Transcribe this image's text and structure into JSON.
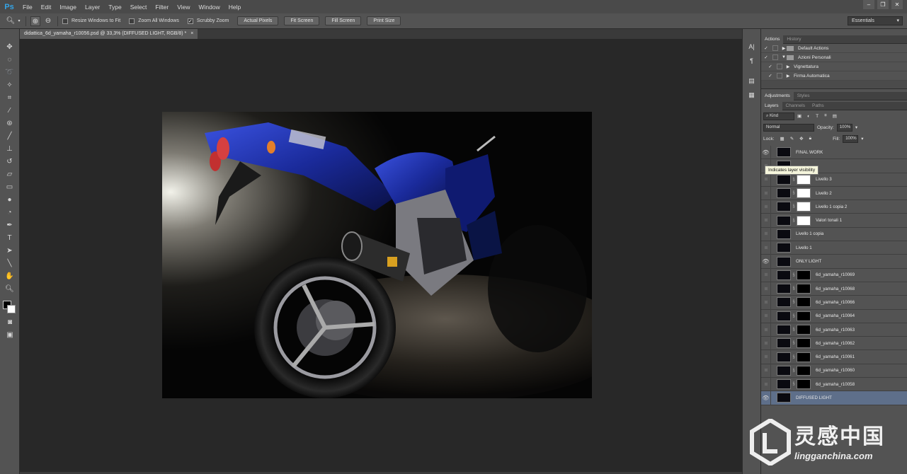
{
  "app": {
    "logo": "Ps"
  },
  "menu": [
    "File",
    "Edit",
    "Image",
    "Layer",
    "Type",
    "Select",
    "Filter",
    "View",
    "Window",
    "Help"
  ],
  "window_controls": [
    "–",
    "❐",
    "✕"
  ],
  "options_bar": {
    "checkboxes": [
      {
        "label": "Resize Windows to Fit",
        "checked": false
      },
      {
        "label": "Zoom All Windows",
        "checked": false
      },
      {
        "label": "Scrubby Zoom",
        "checked": true
      }
    ],
    "buttons": [
      "Actual Pixels",
      "Fit Screen",
      "Fill Screen",
      "Print Size"
    ],
    "workspace": "Essentials"
  },
  "document": {
    "tab_title": "didattica_6d_yamaha_r10056.psd @ 33,3% (DIFFUSED LIGHT, RGB/8) *",
    "close": "×"
  },
  "actions_panel": {
    "tabs": [
      "Actions",
      "History"
    ],
    "rows": [
      {
        "checked": "✓",
        "tri": "▶",
        "name": "Default Actions",
        "folder": true
      },
      {
        "checked": "✓",
        "tri": "▼",
        "name": "Azioni Personali",
        "folder": true
      },
      {
        "checked": "✓",
        "tri": "▶",
        "name": "Vignettatura",
        "folder": false
      },
      {
        "checked": "✓",
        "tri": "▶",
        "name": "Firma Automatica",
        "folder": false
      }
    ]
  },
  "adjustments_panel": {
    "tabs": [
      "Adjustments",
      "Styles"
    ]
  },
  "layers_panel": {
    "tabs": [
      "Layers",
      "Channels",
      "Paths"
    ],
    "kind": "Kind",
    "blend_mode": "Normal",
    "opacity_label": "Opacity:",
    "opacity_value": "100%",
    "lock_label": "Lock:",
    "fill_label": "Fill:",
    "fill_value": "100%",
    "tooltip": "Indicates layer visibility",
    "layers": [
      {
        "name": "FINAL WORK",
        "visible": true,
        "mask": "none",
        "selected": false
      },
      {
        "name": "",
        "visible": false,
        "mask": "none",
        "selected": false
      },
      {
        "name": "Livello 3",
        "visible": false,
        "mask": "white",
        "selected": false
      },
      {
        "name": "Livello 2",
        "visible": false,
        "mask": "white",
        "selected": false
      },
      {
        "name": "Livello 1 copia 2",
        "visible": false,
        "mask": "white",
        "selected": false
      },
      {
        "name": "Valori tonali 1",
        "visible": false,
        "mask": "white",
        "selected": false
      },
      {
        "name": "Livello 1 copia",
        "visible": false,
        "mask": "none",
        "selected": false
      },
      {
        "name": "Livello 1",
        "visible": false,
        "mask": "none",
        "selected": false
      },
      {
        "name": "ONLY LIGHT",
        "visible": true,
        "mask": "none",
        "selected": false
      },
      {
        "name": "6d_yamaha_r10069",
        "visible": false,
        "mask": "black",
        "selected": false
      },
      {
        "name": "6d_yamaha_r10068",
        "visible": false,
        "mask": "black",
        "selected": false
      },
      {
        "name": "6d_yamaha_r10066",
        "visible": false,
        "mask": "black",
        "selected": false
      },
      {
        "name": "6d_yamaha_r10064",
        "visible": false,
        "mask": "black",
        "selected": false
      },
      {
        "name": "6d_yamaha_r10063",
        "visible": false,
        "mask": "black",
        "selected": false
      },
      {
        "name": "6d_yamaha_r10062",
        "visible": false,
        "mask": "black",
        "selected": false
      },
      {
        "name": "6d_yamaha_r10061",
        "visible": false,
        "mask": "black",
        "selected": false
      },
      {
        "name": "6d_yamaha_r10060",
        "visible": false,
        "mask": "black",
        "selected": false
      },
      {
        "name": "6d_yamaha_r10058",
        "visible": false,
        "mask": "black",
        "selected": false
      },
      {
        "name": "DIFFUSED LIGHT",
        "visible": true,
        "mask": "none",
        "selected": true
      }
    ]
  },
  "watermark": {
    "chinese": "灵感中国",
    "url": "lingganchina.com"
  },
  "colors": {
    "accent": "#34a4e6",
    "selected_layer": "#5e6f8a",
    "panel_bg": "#535353",
    "canvas_bg": "#282828",
    "bike_blue": "#1a2a9a"
  }
}
